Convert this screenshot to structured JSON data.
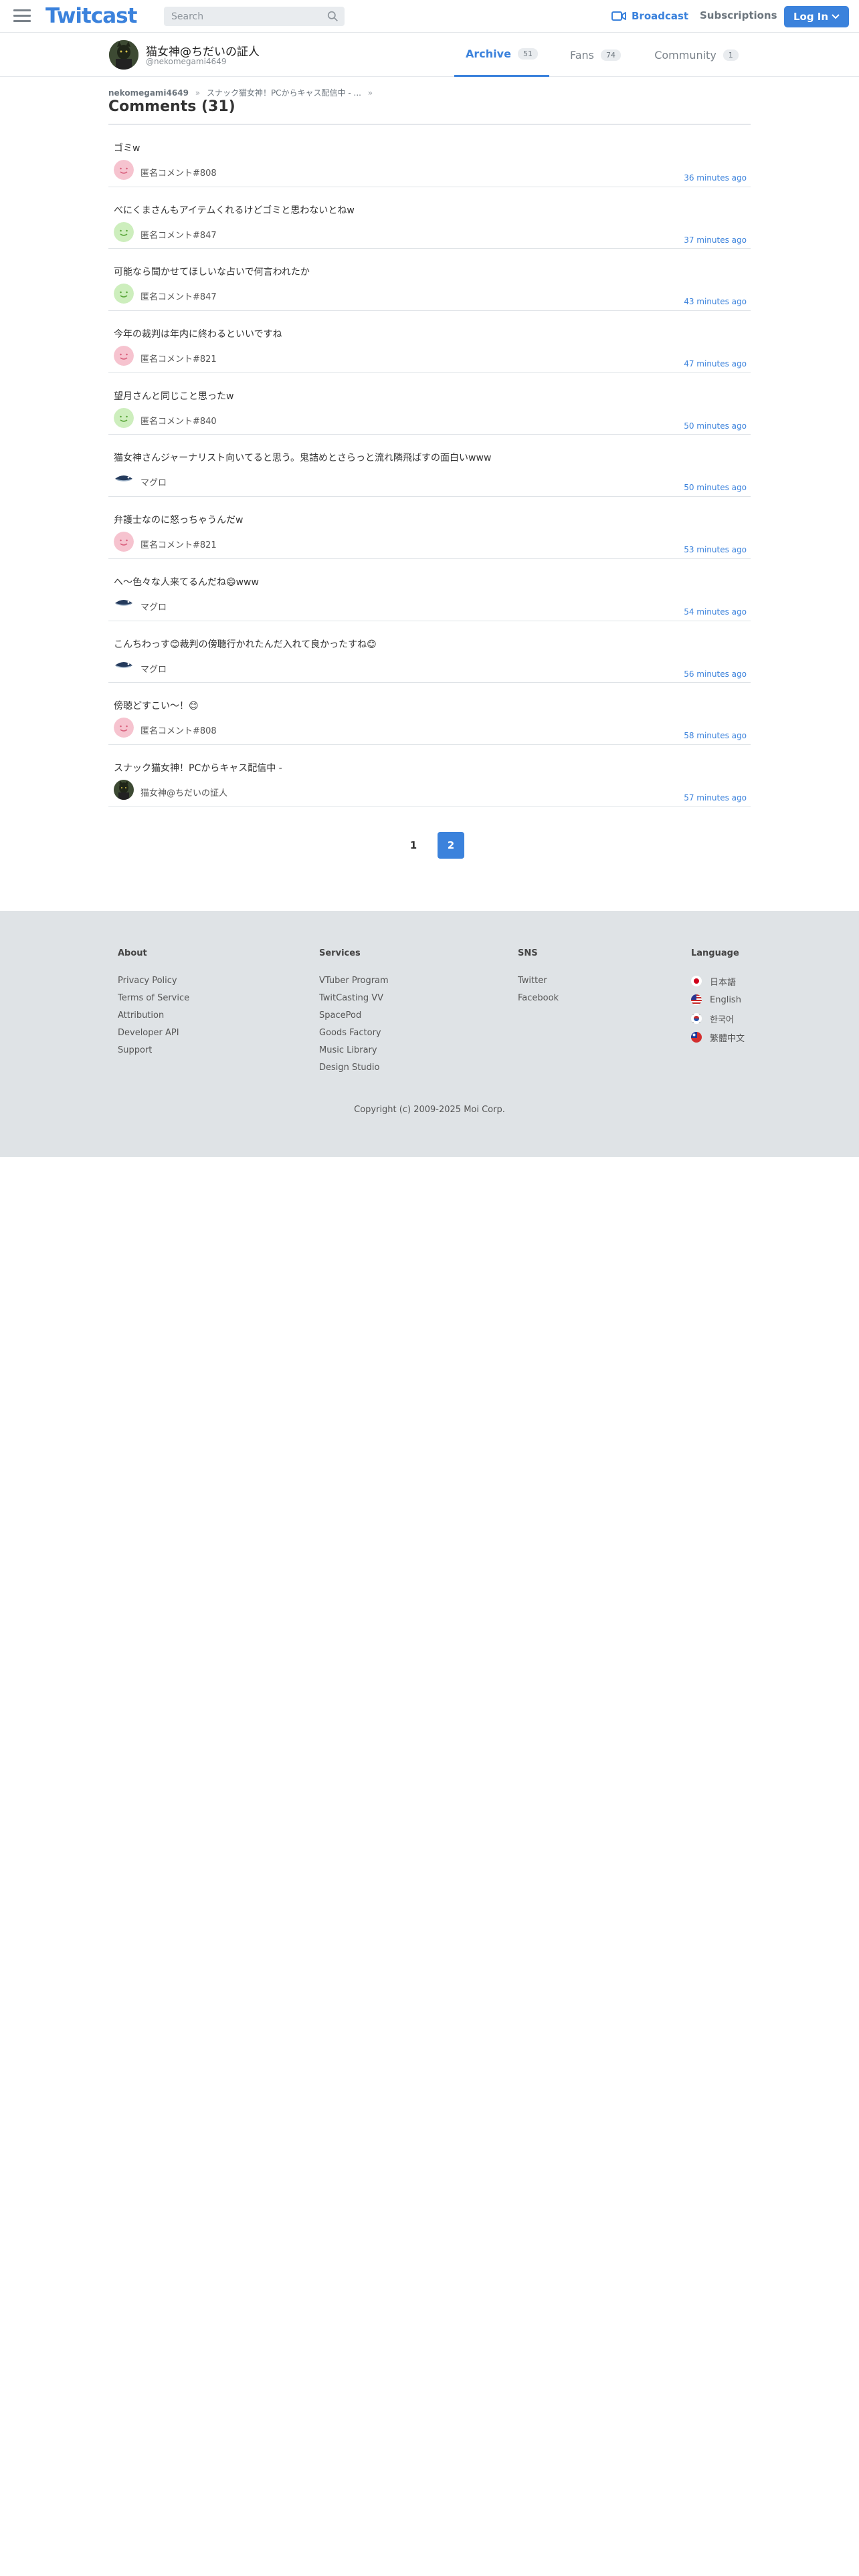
{
  "header": {
    "logo": "Twitcast",
    "search_placeholder": "Search",
    "broadcast_label": "Broadcast",
    "subscriptions_label": "Subscriptions",
    "login_label": "Log In"
  },
  "profile": {
    "name": "猫女神@ちだいの証人",
    "handle": "@nekomegami4649",
    "tabs": [
      {
        "label": "Archive",
        "count": "51",
        "active": true
      },
      {
        "label": "Fans",
        "count": "74",
        "active": false
      },
      {
        "label": "Community",
        "count": "1",
        "active": false
      }
    ]
  },
  "breadcrumb": {
    "user": "nekomegami4649",
    "sep1": "»",
    "movie": "スナック猫女神！PCからキャス配信中 - ...",
    "sep2": "»"
  },
  "page_title": "Comments (31)",
  "comments": [
    {
      "text": "ゴミw",
      "user": "匿名コメント#808",
      "time": "36 minutes ago",
      "avatar": "pink-face"
    },
    {
      "text": "べにくまさんもアイテムくれるけどゴミと思わないとねw",
      "user": "匿名コメント#847",
      "time": "37 minutes ago",
      "avatar": "green-face"
    },
    {
      "text": "可能なら聞かせてほしいな占いで何言われたか",
      "user": "匿名コメント#847",
      "time": "43 minutes ago",
      "avatar": "green-face"
    },
    {
      "text": "今年の裁判は年内に終わるといいですね",
      "user": "匿名コメント#821",
      "time": "47 minutes ago",
      "avatar": "pink-face"
    },
    {
      "text": "望月さんと同じこと思ったw",
      "user": "匿名コメント#840",
      "time": "50 minutes ago",
      "avatar": "green-face"
    },
    {
      "text": "猫女神さんジャーナリスト向いてると思う。鬼詰めとさらっと流れ隣飛ばすの面白いwww",
      "user": "マグロ",
      "time": "50 minutes ago",
      "avatar": "tuna"
    },
    {
      "text": "弁護士なのに怒っちゃうんだw",
      "user": "匿名コメント#821",
      "time": "53 minutes ago",
      "avatar": "pink-face"
    },
    {
      "text": "へ〜色々な人来てるんだね😄www",
      "user": "マグロ",
      "time": "54 minutes ago",
      "avatar": "tuna"
    },
    {
      "text": "こんちわっす😊裁判の傍聴行かれたんだ入れて良かったすね😊",
      "user": "マグロ",
      "time": "56 minutes ago",
      "avatar": "tuna"
    },
    {
      "text": "傍聴どすこい〜！😊",
      "user": "匿名コメント#808",
      "time": "58 minutes ago",
      "avatar": "pink-face"
    },
    {
      "text": "スナック猫女神！PCからキャス配信中 -",
      "user": "猫女神@ちだいの証人",
      "time": "57 minutes ago",
      "avatar": "owner"
    }
  ],
  "pagination": {
    "pages": [
      "1",
      "2"
    ],
    "current": "2"
  },
  "footer": {
    "about": {
      "title": "About",
      "links": [
        "Privacy Policy",
        "Terms of Service",
        "Attribution",
        "Developer API",
        "Support"
      ]
    },
    "services": {
      "title": "Services",
      "links": [
        "VTuber Program",
        "TwitCasting VV",
        "SpacePod",
        "Goods Factory",
        "Music Library",
        "Design Studio"
      ]
    },
    "sns": {
      "title": "SNS",
      "links": [
        "Twitter",
        "Facebook"
      ]
    },
    "language": {
      "title": "Language",
      "items": [
        {
          "label": "日本語",
          "flag": "japan-flag-icon"
        },
        {
          "label": "English",
          "flag": "us-flag-icon"
        },
        {
          "label": "한국어",
          "flag": "korea-flag-icon"
        },
        {
          "label": "繁體中文",
          "flag": "taiwan-flag-icon"
        }
      ]
    },
    "copyright": "Copyright (c) 2009-2025 Moi Corp."
  },
  "colors": {
    "accent": "#3b82dc",
    "footer_bg": "#dfe3e6",
    "divider": "#dfe3e7"
  }
}
